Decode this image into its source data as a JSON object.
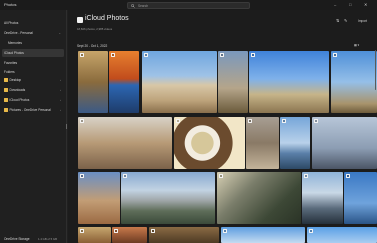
{
  "titlebar": {
    "app_name": "Photos",
    "search_placeholder": "Search",
    "minimize": "–",
    "maximize": "□",
    "close": "✕"
  },
  "sidebar": {
    "items": [
      {
        "label": "All Photos",
        "icon": "photos-icon"
      },
      {
        "label": "OneDrive - Personal",
        "icon": "cloud-icon"
      },
      {
        "label": "Memories",
        "icon": "memories-icon"
      },
      {
        "label": "iCloud Photos",
        "icon": "icloud-icon",
        "selected": true
      },
      {
        "label": "Favorites",
        "icon": "heart-icon"
      }
    ],
    "folders_label": "Folders",
    "folders": [
      {
        "label": "Desktop"
      },
      {
        "label": "Downloads"
      },
      {
        "label": "iCloud Photos"
      },
      {
        "label": "Pictures - OneDrive Personal"
      }
    ],
    "storage": {
      "label": "OneDrive Storage",
      "value": "1.4 GB of 5 GB",
      "fraction": 0.28
    }
  },
  "main": {
    "title": "iCloud Photos",
    "subtitle": "18,826 photos, 2,985 videos",
    "date_range": "Sept 20 - Oct 1, 2022",
    "filter_label": "⇅",
    "edit_label": "✎",
    "import_label": "Import",
    "grid_label": "▦ ▾"
  },
  "colors": {
    "accent": "#4aa0ff",
    "background": "#1c1c1c",
    "sidebar": "#202020"
  }
}
